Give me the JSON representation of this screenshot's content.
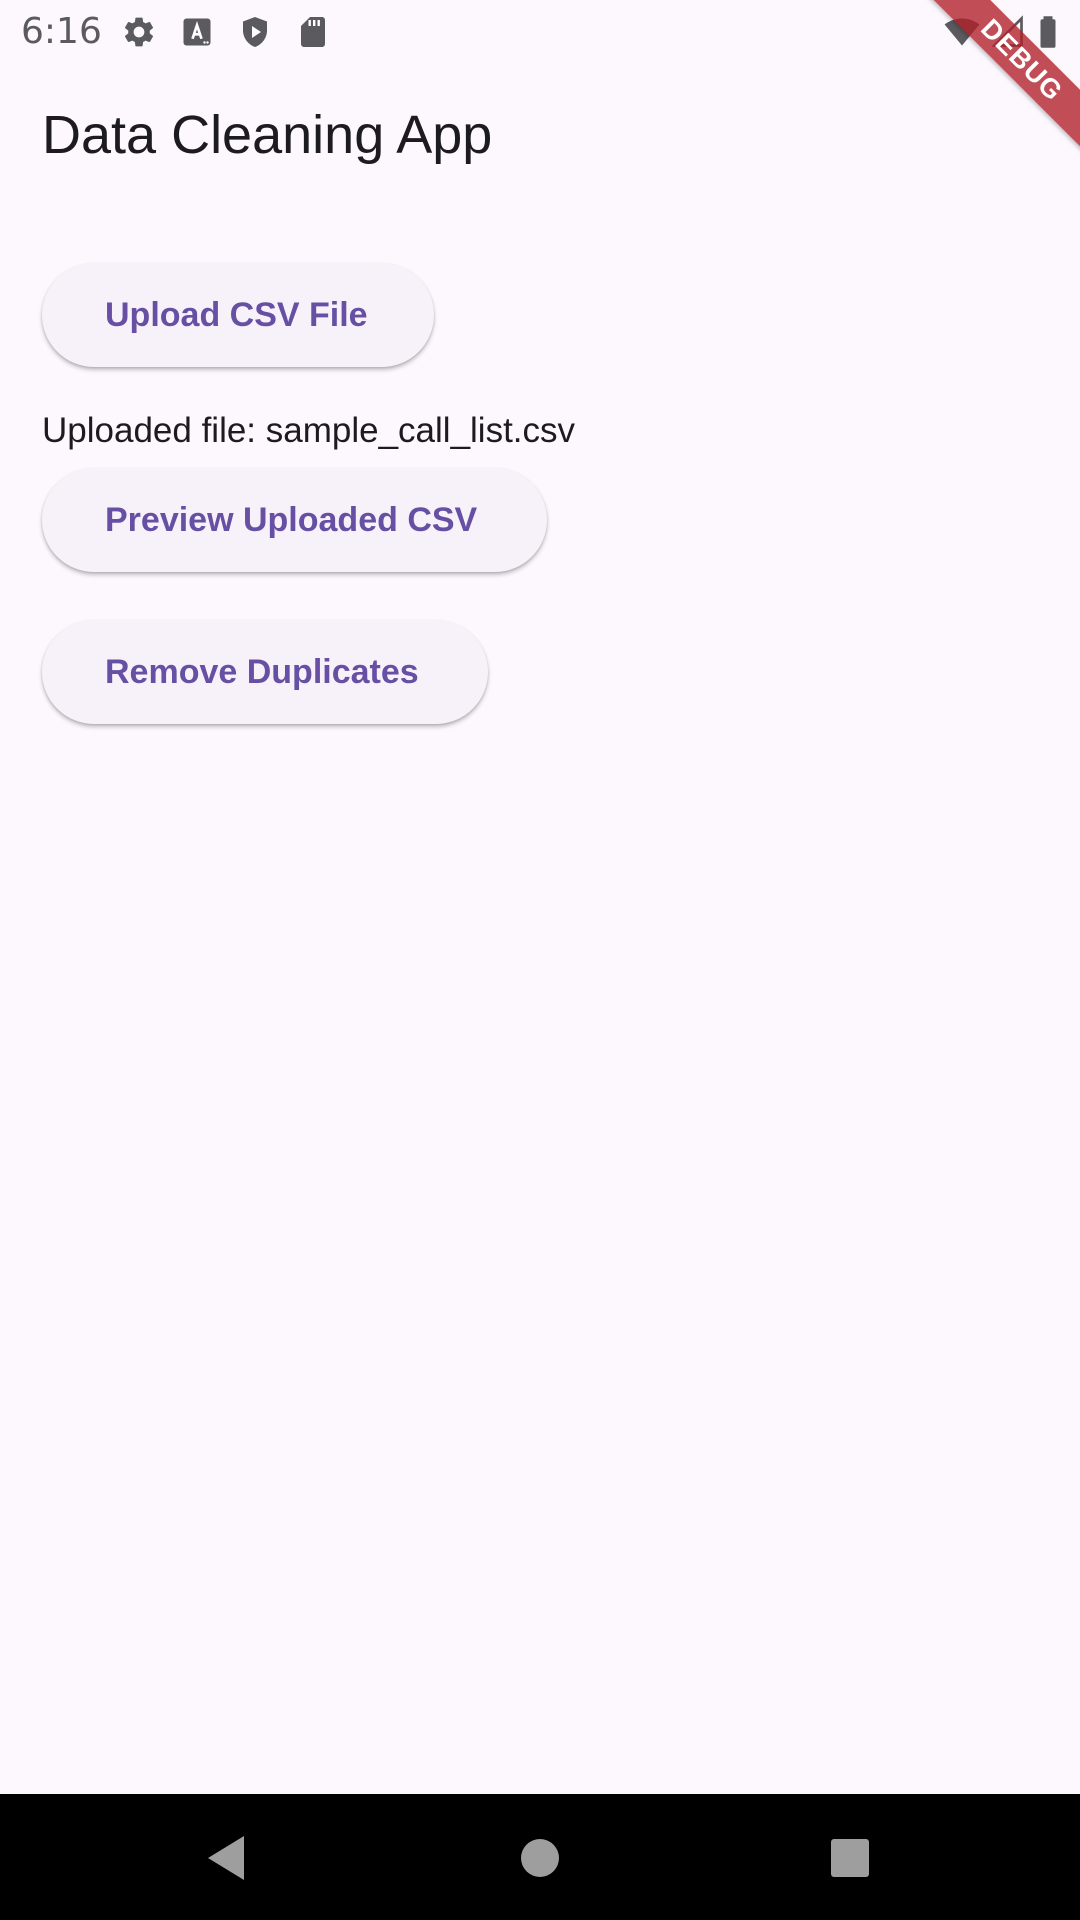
{
  "status_bar": {
    "time": "6:16",
    "left_icons": [
      "gear-icon",
      "text-a-icon",
      "shield-play-icon",
      "sd-card-icon"
    ],
    "right_icons": [
      "wifi-icon",
      "cell-signal-icon",
      "battery-icon"
    ],
    "icon_color": "#5B5B5F"
  },
  "debug_banner": {
    "label": "DEBUG",
    "color": "#B01F28"
  },
  "app_bar": {
    "title": "Data Cleaning App"
  },
  "main": {
    "upload_button_label": "Upload CSV File",
    "uploaded_file_text": "Uploaded file: sample_call_list.csv",
    "preview_button_label": "Preview Uploaded CSV",
    "remove_duplicates_button_label": "Remove Duplicates"
  },
  "colors": {
    "background": "#FDF7FE",
    "button_background": "#F7F2FA",
    "accent": "#6750A4",
    "text": "#1C1B1F",
    "nav_bar": "#000000"
  },
  "nav_bar": {
    "buttons": [
      "back-icon",
      "home-icon",
      "recents-icon"
    ]
  }
}
